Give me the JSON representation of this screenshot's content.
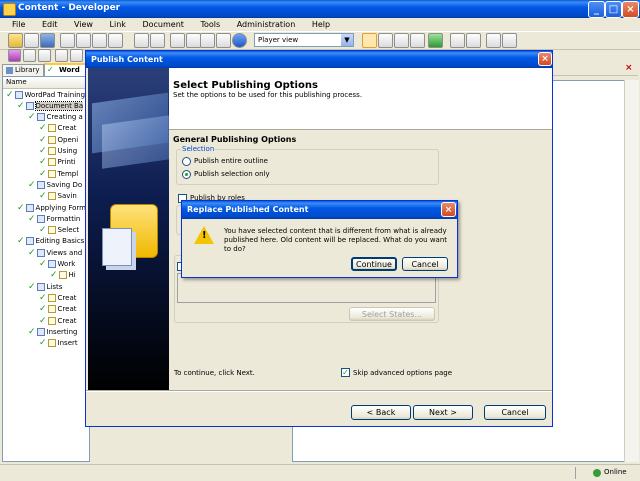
{
  "main_window": {
    "title": "Content - Developer",
    "menu": [
      "File",
      "Edit",
      "View",
      "Link",
      "Document",
      "Tools",
      "Administration",
      "Help"
    ],
    "toolbar_view_select": "Player view",
    "tabs": [
      "Library",
      "Word"
    ],
    "tree_header": "Name",
    "tree_items": [
      {
        "label": "WordPad Training",
        "indent": 0,
        "icon": "module"
      },
      {
        "label": "Document Ba",
        "indent": 1,
        "icon": "section",
        "selected": true
      },
      {
        "label": "Creating a",
        "indent": 2,
        "icon": "section"
      },
      {
        "label": "Creat",
        "indent": 3,
        "icon": "doc"
      },
      {
        "label": "Openi",
        "indent": 3,
        "icon": "doc"
      },
      {
        "label": "Using",
        "indent": 3,
        "icon": "doc"
      },
      {
        "label": "Printi",
        "indent": 3,
        "icon": "doc"
      },
      {
        "label": "Templ",
        "indent": 3,
        "icon": "doc"
      },
      {
        "label": "Saving Do",
        "indent": 2,
        "icon": "section"
      },
      {
        "label": "Savin",
        "indent": 3,
        "icon": "doc"
      },
      {
        "label": "Applying Form",
        "indent": 1,
        "icon": "section"
      },
      {
        "label": "Formattin",
        "indent": 2,
        "icon": "section"
      },
      {
        "label": "Select",
        "indent": 3,
        "icon": "doc"
      },
      {
        "label": "Editing Basics",
        "indent": 1,
        "icon": "section"
      },
      {
        "label": "Views and",
        "indent": 2,
        "icon": "section"
      },
      {
        "label": "Work",
        "indent": 3,
        "icon": "section"
      },
      {
        "label": "Hi",
        "indent": 4,
        "icon": "doc"
      },
      {
        "label": "Lists",
        "indent": 2,
        "icon": "section"
      },
      {
        "label": "Creat",
        "indent": 3,
        "icon": "doc"
      },
      {
        "label": "Creat",
        "indent": 3,
        "icon": "doc"
      },
      {
        "label": "Creat",
        "indent": 3,
        "icon": "doc"
      },
      {
        "label": "Inserting",
        "indent": 2,
        "icon": "section"
      },
      {
        "label": "Insert",
        "indent": 3,
        "icon": "doc"
      }
    ],
    "status_online": "Online"
  },
  "publish_dialog": {
    "title": "Publish Content",
    "heading": "Select Publishing Options",
    "subheading": "Set the options to be used for this publishing process.",
    "group_title": "General Publishing Options",
    "selection_label": "Selection",
    "radio_entire": "Publish entire outline",
    "radio_selection": "Publish selection only",
    "publish_by_roles": "Publish by roles",
    "select_states": "Select States...",
    "continue_hint": "To continue, click Next.",
    "skip_advanced": "Skip advanced options page",
    "back_button": "< Back",
    "next_button": "Next >",
    "cancel_button": "Cancel"
  },
  "replace_dialog": {
    "title": "Replace Published Content",
    "message": "You have selected content that is different from what is already published here. Old content will be replaced. What do you want to do?",
    "continue_button": "Continue",
    "cancel_button": "Cancel"
  }
}
